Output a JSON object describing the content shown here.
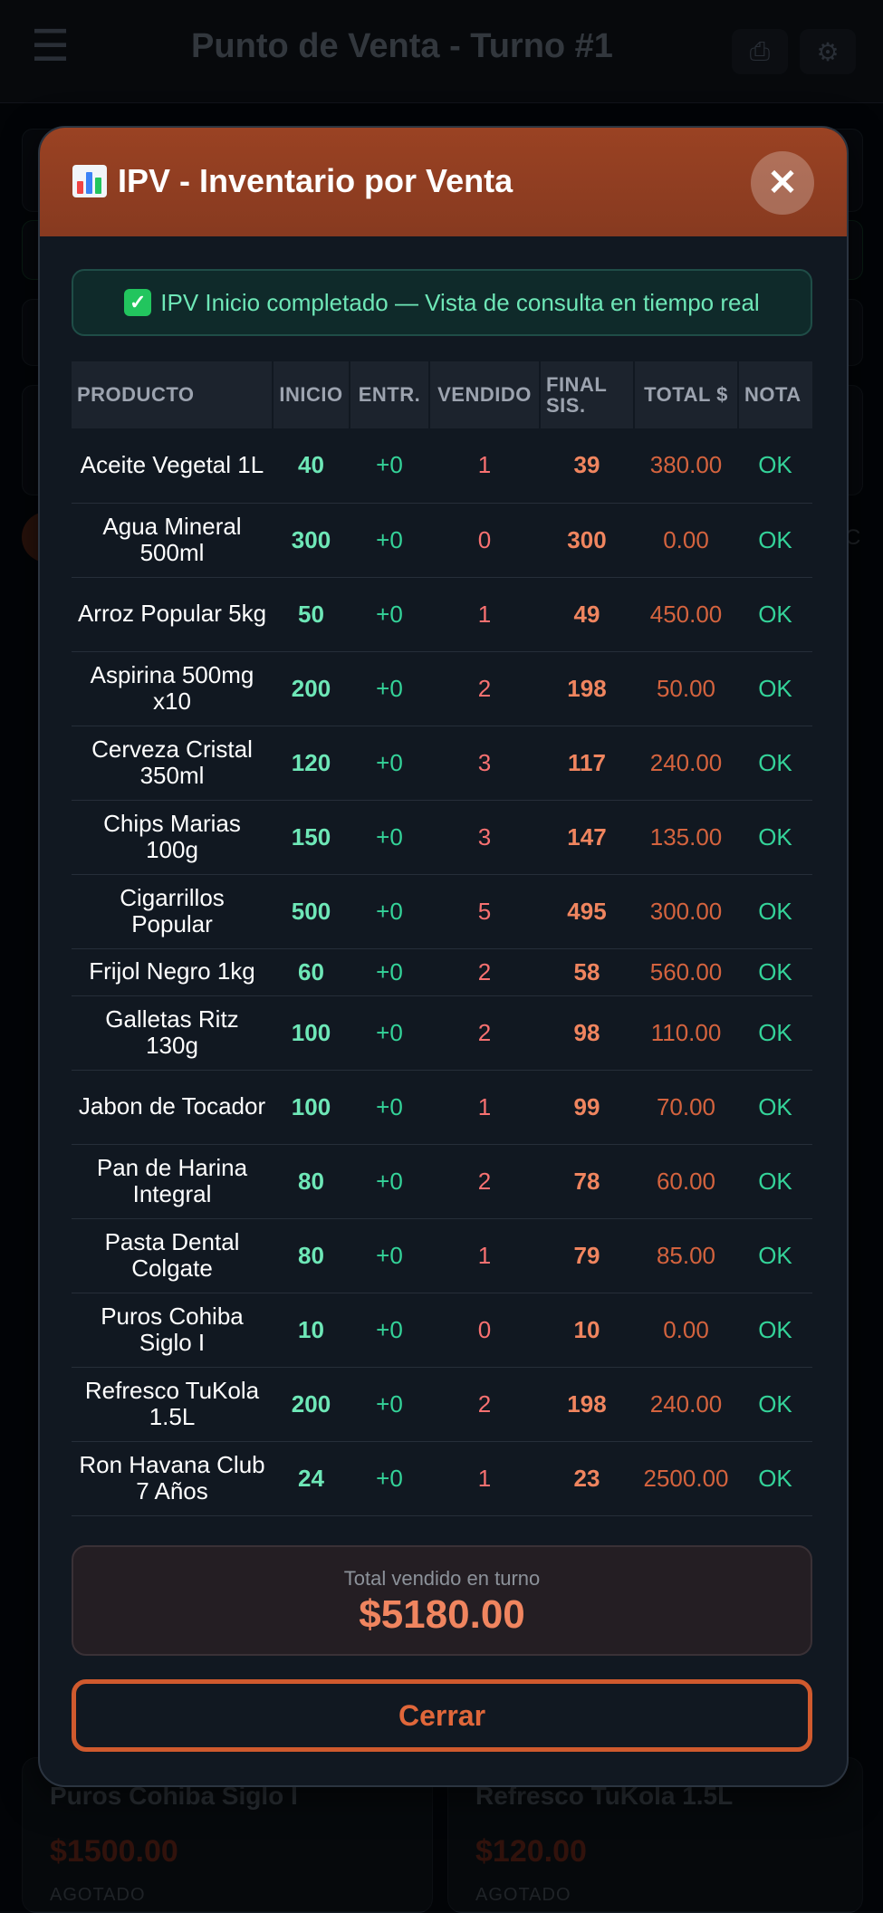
{
  "app": {
    "title": "Punto de Venta - Turno #1",
    "print_icon": "printer-icon",
    "settings_icon": "gear-icon"
  },
  "background_products": [
    {
      "name": "Puros Cohiba Siglo I",
      "price": "$1500.00",
      "status": "AGOTADO"
    },
    {
      "name": "Refresco TuKola 1.5L",
      "price": "$120.00",
      "status": "AGOTADO"
    }
  ],
  "background_partial_text": "C",
  "modal": {
    "title": "IPV - Inventario por Venta",
    "title_icon": "bar-chart-icon",
    "close_label": "✕",
    "banner_icon": "check-mark-icon",
    "banner_text": "IPV Inicio completado — Vista de consulta en tiempo real",
    "columns": [
      "PRODUCTO",
      "INICIO",
      "ENTR.",
      "VENDIDO",
      "FINAL SIS.",
      "TOTAL $",
      "NOTA"
    ],
    "rows": [
      {
        "producto": "Aceite Vegetal 1L",
        "inicio": "40",
        "entr": "+0",
        "vendido": "1",
        "final": "39",
        "total": "380.00",
        "nota": "OK"
      },
      {
        "producto": "Agua Mineral 500ml",
        "inicio": "300",
        "entr": "+0",
        "vendido": "0",
        "final": "300",
        "total": "0.00",
        "nota": "OK"
      },
      {
        "producto": "Arroz Popular 5kg",
        "inicio": "50",
        "entr": "+0",
        "vendido": "1",
        "final": "49",
        "total": "450.00",
        "nota": "OK"
      },
      {
        "producto": "Aspirina 500mg x10",
        "inicio": "200",
        "entr": "+0",
        "vendido": "2",
        "final": "198",
        "total": "50.00",
        "nota": "OK"
      },
      {
        "producto": "Cerveza Cristal 350ml",
        "inicio": "120",
        "entr": "+0",
        "vendido": "3",
        "final": "117",
        "total": "240.00",
        "nota": "OK"
      },
      {
        "producto": "Chips Marias 100g",
        "inicio": "150",
        "entr": "+0",
        "vendido": "3",
        "final": "147",
        "total": "135.00",
        "nota": "OK"
      },
      {
        "producto": "Cigarrillos Popular",
        "inicio": "500",
        "entr": "+0",
        "vendido": "5",
        "final": "495",
        "total": "300.00",
        "nota": "OK"
      },
      {
        "producto": "Frijol Negro 1kg",
        "inicio": "60",
        "entr": "+0",
        "vendido": "2",
        "final": "58",
        "total": "560.00",
        "nota": "OK"
      },
      {
        "producto": "Galletas Ritz 130g",
        "inicio": "100",
        "entr": "+0",
        "vendido": "2",
        "final": "98",
        "total": "110.00",
        "nota": "OK"
      },
      {
        "producto": "Jabon de Tocador",
        "inicio": "100",
        "entr": "+0",
        "vendido": "1",
        "final": "99",
        "total": "70.00",
        "nota": "OK"
      },
      {
        "producto": "Pan de Harina Integral",
        "inicio": "80",
        "entr": "+0",
        "vendido": "2",
        "final": "78",
        "total": "60.00",
        "nota": "OK"
      },
      {
        "producto": "Pasta Dental Colgate",
        "inicio": "80",
        "entr": "+0",
        "vendido": "1",
        "final": "79",
        "total": "85.00",
        "nota": "OK"
      },
      {
        "producto": "Puros Cohiba Siglo I",
        "inicio": "10",
        "entr": "+0",
        "vendido": "0",
        "final": "10",
        "total": "0.00",
        "nota": "OK"
      },
      {
        "producto": "Refresco TuKola 1.5L",
        "inicio": "200",
        "entr": "+0",
        "vendido": "2",
        "final": "198",
        "total": "240.00",
        "nota": "OK"
      },
      {
        "producto": "Ron Havana Club 7 Años",
        "inicio": "24",
        "entr": "+0",
        "vendido": "1",
        "final": "23",
        "total": "2500.00",
        "nota": "OK"
      }
    ],
    "summary_label": "Total vendido en turno",
    "summary_value": "$5180.00",
    "close_button_label": "Cerrar"
  },
  "colors": {
    "accent": "#9a4223",
    "ok_green": "#34d399",
    "sold_red": "#f87171",
    "final_orange": "#f0855f"
  }
}
